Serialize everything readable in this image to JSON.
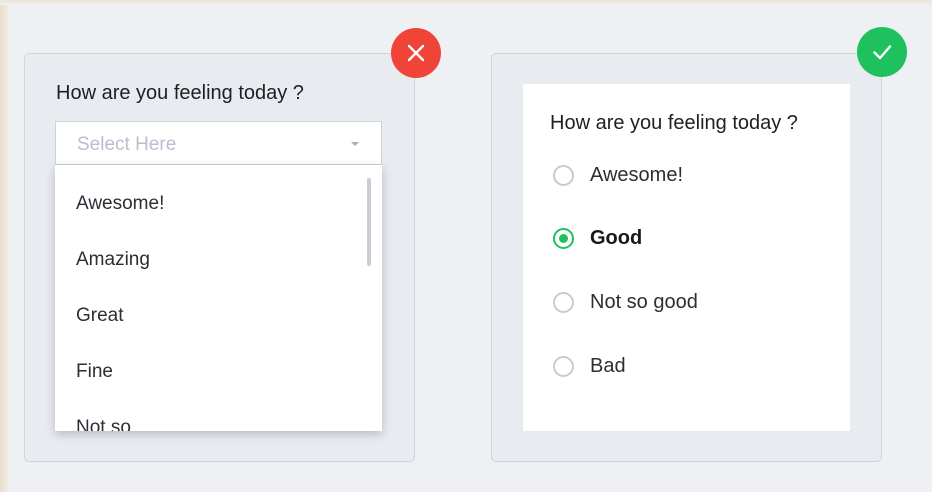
{
  "left_example": {
    "question": "How are you feeling today ?",
    "select": {
      "placeholder": "Select Here"
    },
    "options": [
      "Awesome!",
      "Amazing",
      "Great",
      "Fine",
      "Not so"
    ],
    "status_icon": "close-icon",
    "status_color": "#f04438"
  },
  "right_example": {
    "question": "How are you feeling today ?",
    "options": [
      {
        "label": "Awesome!",
        "selected": false
      },
      {
        "label": "Good",
        "selected": true
      },
      {
        "label": "Not so good",
        "selected": false
      },
      {
        "label": "Bad",
        "selected": false
      }
    ],
    "selected_value": "Good",
    "status_icon": "check-icon",
    "status_color": "#1fc15f"
  }
}
